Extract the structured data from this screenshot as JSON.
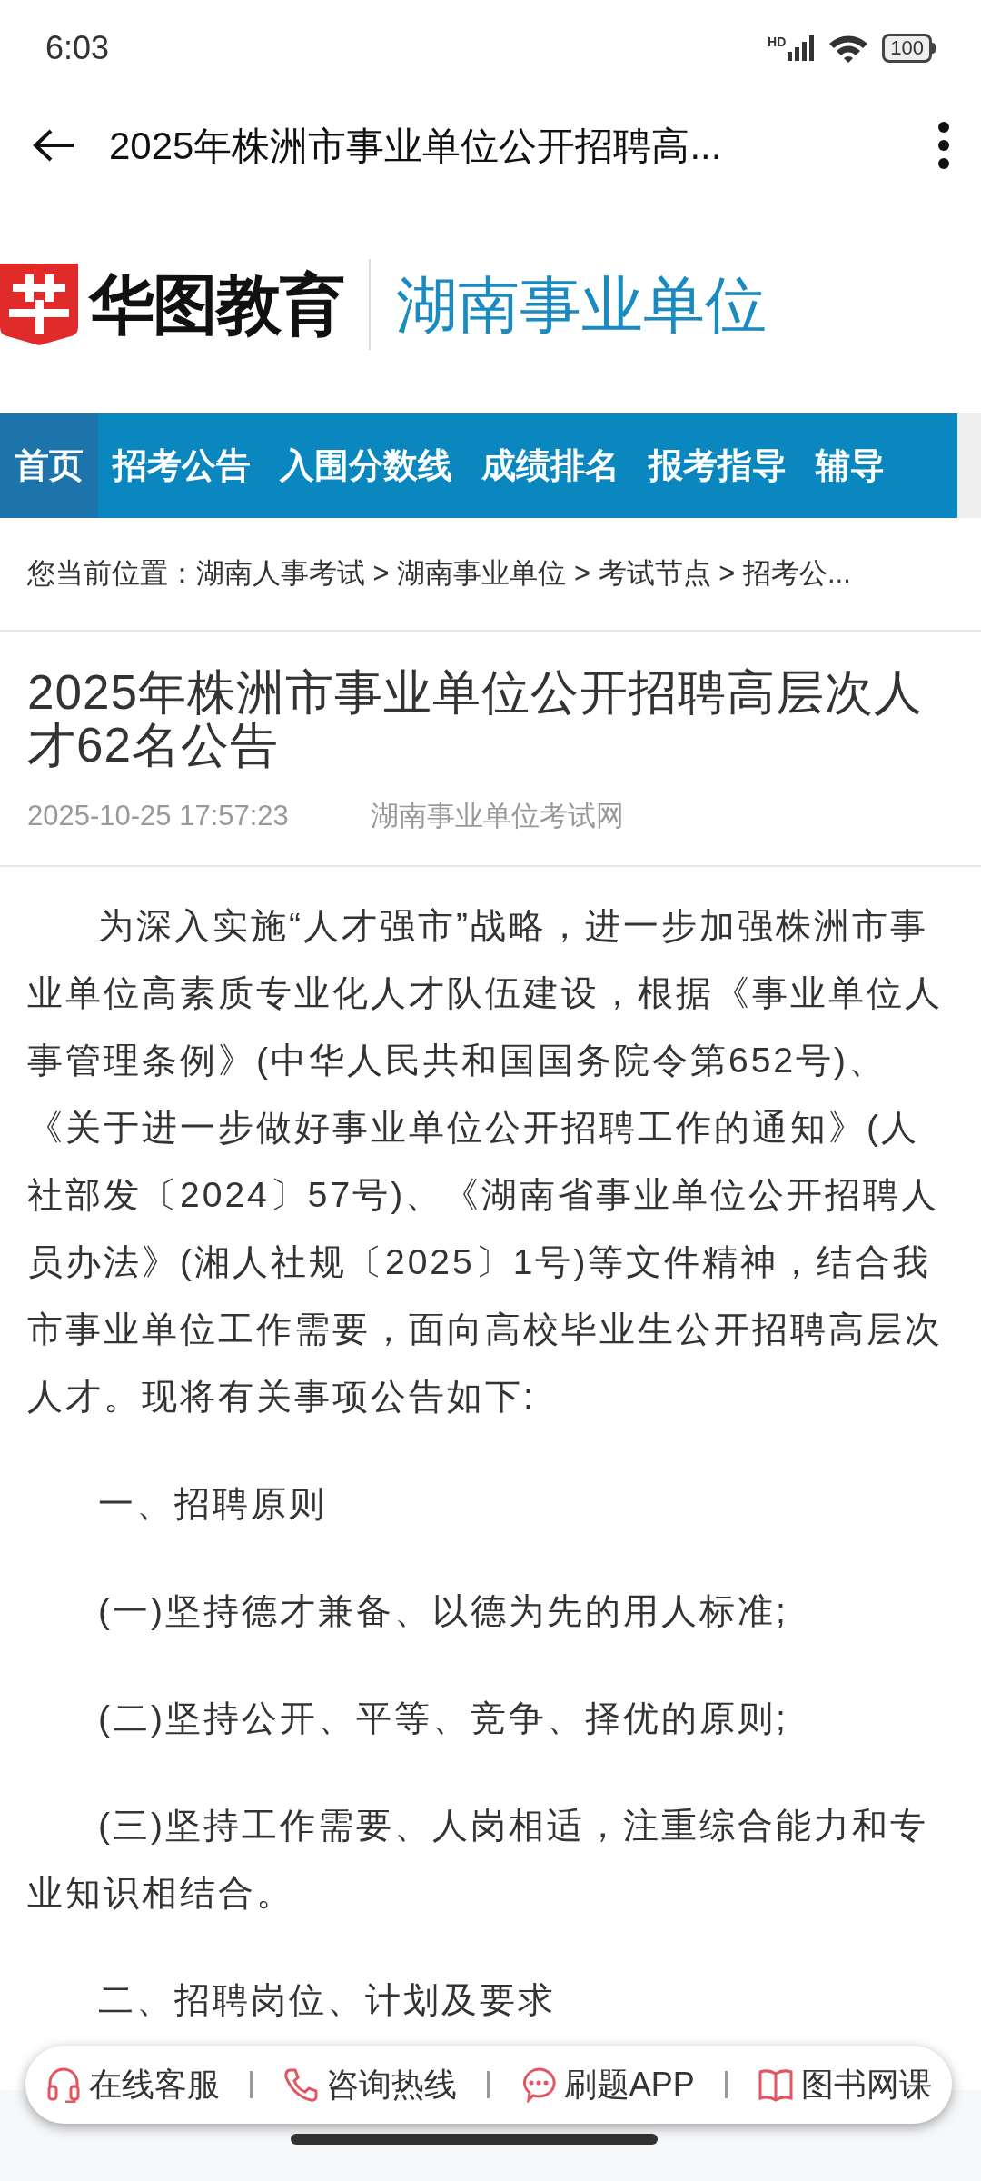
{
  "status_bar": {
    "time": "6:03",
    "network": "HD",
    "battery": "100"
  },
  "app_bar": {
    "title": "2025年株洲市事业单位公开招聘高..."
  },
  "site_header": {
    "brand": "华图教育",
    "section": "湖南事业单位"
  },
  "nav": [
    {
      "label": "首页",
      "selected": true
    },
    {
      "label": "招考公告",
      "selected": false
    },
    {
      "label": "入围分数线",
      "selected": false
    },
    {
      "label": "成绩排名",
      "selected": false
    },
    {
      "label": "报考指导",
      "selected": false
    },
    {
      "label": "辅导",
      "selected": false
    }
  ],
  "breadcrumb": "您当前位置：湖南人事考试 > 湖南事业单位 > 考试节点 > 招考公...",
  "article": {
    "title": "2025年株洲市事业单位公开招聘高层次人才62名公告",
    "date": "2025-10-25 17:57:23",
    "source": "湖南事业单位考试网",
    "paragraphs": [
      "为深入实施“人才强市”战略，进一步加强株洲市事业单位高素质专业化人才队伍建设，根据《事业单位人事管理条例》(中华人民共和国国务院令第652号)、《关于进一步做好事业单位公开招聘工作的通知》(人社部发〔2024〕57号)、《湖南省事业单位公开招聘人员办法》(湘人社规〔2025〕1号)等文件精神，结合我市事业单位工作需要，面向高校毕业生公开招聘高层次人才。现将有关事项公告如下:",
      "一、招聘原则",
      "(一)坚持德才兼备、以德为先的用人标准;",
      "(二)坚持公开、平等、竞争、择优的原则;",
      "(三)坚持工作需要、人岗相适，注重综合能力和专业知识相结合。",
      "二、招聘岗位、计划及要求"
    ]
  },
  "bottom_bar": [
    {
      "kind": "headset",
      "label": "在线客服"
    },
    {
      "kind": "phone",
      "label": "咨询热线"
    },
    {
      "kind": "chat",
      "label": "刷题APP"
    },
    {
      "kind": "book",
      "label": "图书网课"
    }
  ]
}
